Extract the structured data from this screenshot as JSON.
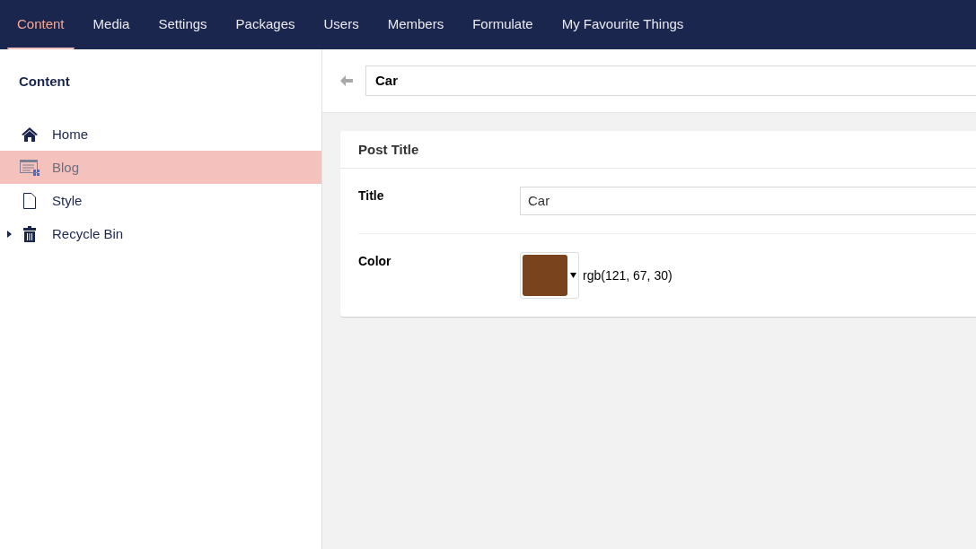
{
  "nav": [
    {
      "label": "Content",
      "selected": true
    },
    {
      "label": "Media",
      "selected": false
    },
    {
      "label": "Settings",
      "selected": false
    },
    {
      "label": "Packages",
      "selected": false
    },
    {
      "label": "Users",
      "selected": false
    },
    {
      "label": "Members",
      "selected": false
    },
    {
      "label": "Formulate",
      "selected": false
    },
    {
      "label": "My Favourite Things",
      "selected": false
    }
  ],
  "sidebar": {
    "title": "Content",
    "items": [
      {
        "label": "Home",
        "kind": "home",
        "selected": false
      },
      {
        "label": "Blog",
        "kind": "list",
        "selected": true
      },
      {
        "label": "Style",
        "kind": "document",
        "selected": false
      },
      {
        "label": "Recycle Bin",
        "kind": "trash",
        "selected": false,
        "expanded": false
      }
    ]
  },
  "editor": {
    "name": "Car",
    "group": {
      "title": "Post Title",
      "properties": [
        {
          "label": "Title",
          "kind": "text",
          "value": "Car"
        },
        {
          "label": "Color",
          "kind": "color",
          "color": "#79431e",
          "value": "rgb(121, 67, 30)"
        }
      ]
    }
  }
}
